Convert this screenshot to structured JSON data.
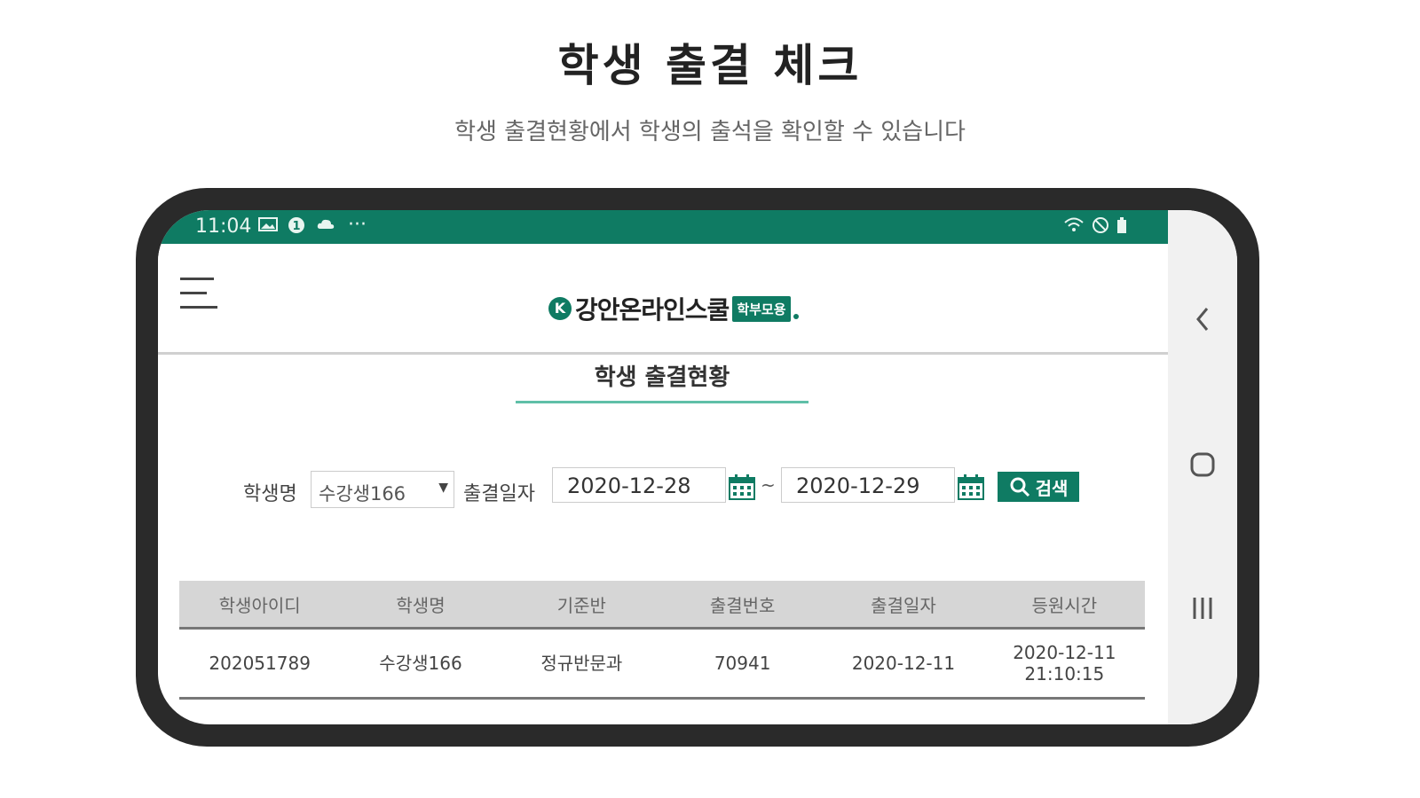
{
  "hero": {
    "title": "학생 출결 체크",
    "subtitle": "학생 출결현황에서 학생의 출석을 확인할 수 있습니다"
  },
  "status_bar": {
    "time": "11:04",
    "more": "···"
  },
  "app": {
    "logo_text": "강안온라인스쿨",
    "logo_badge": "학부모용",
    "section_title": "학생 출결현황"
  },
  "search": {
    "student_label": "학생명",
    "student_selected": "수강생166",
    "date_label": "출결일자",
    "date_from": "2020-12-28",
    "date_to": "2020-12-29",
    "range_separator": "~",
    "search_button": "검색"
  },
  "table": {
    "columns": [
      "학생아이디",
      "학생명",
      "기준반",
      "출결번호",
      "출결일자",
      "등원시간"
    ],
    "rows": [
      [
        "202051789",
        "수강생166",
        "정규반문과",
        "70941",
        "2020-12-11",
        "2020-12-11\n21:10:15"
      ]
    ]
  },
  "colors": {
    "brand_green": "#0f7b63",
    "accent_teal": "#5fbfa8",
    "phone_frame": "#2a2a2a"
  },
  "icons": [
    "gallery-icon",
    "notification-badge-icon",
    "cloud-icon",
    "wifi-icon",
    "dnd-icon",
    "battery-icon",
    "menu-icon",
    "calendar-icon",
    "search-icon",
    "back-icon",
    "home-icon",
    "recents-icon"
  ]
}
